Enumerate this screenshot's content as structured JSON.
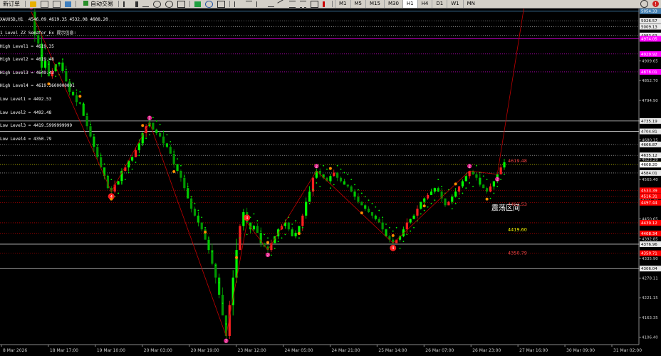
{
  "toolbar": {
    "new_order": "新订单",
    "auto_trade": "自动交易",
    "timeframes": [
      "M1",
      "M5",
      "M15",
      "M30",
      "H1",
      "H4",
      "D1",
      "W1",
      "MN"
    ],
    "active_timeframe": "H1"
  },
  "info": {
    "header": "XAUUSD,H1  4546.09 4619.35 4532.08 4608.20",
    "indicator": "1 Level ZZ Semafor_Ex 提示信息:",
    "lines": [
      "High Level1 = 4619.35",
      "High Level2 = 4619.48",
      "High Level3 = 4649.43",
      "High Level4 = 4619.3600000001",
      "Low Level1 = 4492.53",
      "Low Level2 = 4492.48",
      "Low Level3 = 4419.5999999999",
      "Low Level4 = 4350.79"
    ]
  },
  "annotation": "震荡区间",
  "chart_data": {
    "type": "candlestick",
    "symbol": "XAUUSD",
    "timeframe": "H1",
    "ohlc": {
      "open": 4546.09,
      "high": 4619.35,
      "low": 4532.08,
      "close": 4608.2
    },
    "ylim": [
      4085,
      5062
    ],
    "x_ticks": [
      "8 Mar 2026",
      "18 Mar 17:00",
      "19 Mar 10:00",
      "20 Mar 03:00",
      "20 Mar 19:00",
      "23 Mar 12:00",
      "24 Mar 05:00",
      "24 Mar 21:00",
      "25 Mar 14:00",
      "26 Mar 07:00",
      "26 Mar 23:00",
      "27 Mar 16:00",
      "30 Mar 09:00",
      "31 Mar 02:00"
    ],
    "y_ticks": [
      4909.65,
      4852.7,
      4794.9,
      4735.19,
      4680.15,
      4623.29,
      4565.4,
      4507.7,
      4450.65,
      4392.85,
      4335.9,
      4278.11,
      4221.15,
      4163.35,
      4106.4
    ],
    "path": [
      5052,
      4985,
      4960,
      4890,
      4910,
      4865,
      4880,
      4900,
      4905,
      4880,
      4850,
      4820,
      4810,
      4790,
      4785,
      4750,
      4720,
      4690,
      4660,
      4630,
      4600,
      4575,
      4540,
      4530,
      4550,
      4560,
      4590,
      4600,
      4620,
      4630,
      4650,
      4670,
      4700,
      4720,
      4730,
      4710,
      4700,
      4690,
      4670,
      4660,
      4640,
      4610,
      4590,
      4570,
      4540,
      4510,
      4480,
      4460,
      4440,
      4420,
      4390,
      4360,
      4320,
      4280,
      4230,
      4170,
      4110,
      4200,
      4280,
      4360,
      4430,
      4470,
      4440,
      4420,
      4430,
      4410,
      4380,
      4370,
      4360,
      4380,
      4400,
      4420,
      4430,
      4440,
      4420,
      4400,
      4410,
      4430,
      4460,
      4500,
      4530,
      4570,
      4590,
      4580,
      4570,
      4560,
      4575,
      4585,
      4570,
      4560,
      4550,
      4545,
      4530,
      4515,
      4500,
      4490,
      4480,
      4470,
      4460,
      4450,
      4440,
      4420,
      4400,
      4390,
      4380,
      4390,
      4400,
      4420,
      4440,
      4450,
      4460,
      4480,
      4500,
      4510,
      4520,
      4530,
      4540,
      4530,
      4510,
      4490,
      4500,
      4515,
      4530,
      4545,
      4560,
      4575,
      4590,
      4580,
      4570,
      4550,
      4540,
      4530,
      4545,
      4560,
      4580,
      4600,
      4615
    ],
    "series": [
      {
        "price": 5054.33,
        "label": "5054.33",
        "color": "#4682b4",
        "style": "solid"
      },
      {
        "price": 5026.57,
        "label": "5026.57",
        "color": "#cccccc",
        "style": "dotted"
      },
      {
        "price": 5009.13,
        "label": "5009.13",
        "color": "#cccccc",
        "style": "dotted"
      },
      {
        "price": 4983.63,
        "label": "4983.63",
        "color": "#cccccc",
        "style": "dotted"
      },
      {
        "price": 4974.05,
        "label": "4974.05",
        "color": "#ff00ff",
        "style": "solid"
      },
      {
        "price": 4929.92,
        "label": "4929.92",
        "color": "#ff00ff",
        "style": "dotted"
      },
      {
        "price": 4878.01,
        "label": "4878.01",
        "color": "#ff00ff",
        "style": "dotted"
      },
      {
        "price": 4735.19,
        "label": "4735.19",
        "color": "#cccccc",
        "style": "solid"
      },
      {
        "price": 4704.81,
        "label": "4704.81",
        "color": "#cccccc",
        "style": "solid"
      },
      {
        "price": 4666.87,
        "label": "4666.87",
        "color": "#cccccc",
        "style": "dotted"
      },
      {
        "price": 4635.12,
        "label": "4635.12",
        "color": "#cccccc",
        "style": "dotted"
      },
      {
        "price": 4608.59,
        "label": "4608.59",
        "color": "#ffff00",
        "style": "dotted"
      },
      {
        "price": 4584.01,
        "label": "4584.01",
        "color": "#cccccc",
        "style": "dotted"
      },
      {
        "price": 4533.39,
        "label": "4533.39",
        "color": "#ff0000",
        "style": "dotted"
      },
      {
        "price": 4516.31,
        "label": "4516.31",
        "color": "#ff0000",
        "style": "dotted"
      },
      {
        "price": 4497.44,
        "label": "4497.44",
        "color": "#ff0000",
        "style": "dotted"
      },
      {
        "price": 4439.12,
        "label": "4439.12",
        "color": "#ff0000",
        "style": "dotted"
      },
      {
        "price": 4408.34,
        "label": "4408.34",
        "color": "#ff0000",
        "style": "dotted"
      },
      {
        "price": 4376.96,
        "label": "4376.96",
        "color": "#cccccc",
        "style": "solid"
      },
      {
        "price": 4350.71,
        "label": "4350.71",
        "color": "#ff0000",
        "style": "dotted"
      },
      {
        "price": 4306.04,
        "label": "4306.04",
        "color": "#cccccc",
        "style": "solid"
      }
    ],
    "level_labels": [
      {
        "price": 4619.48,
        "label": "4619.48",
        "color": "#ff4444"
      },
      {
        "price": 4492.53,
        "label": "4492.53",
        "color": "#ff4444"
      },
      {
        "price": 4419.6,
        "label": "4419.60",
        "color": "#ffff00"
      },
      {
        "price": 4350.79,
        "label": "4350.79",
        "color": "#ff4444"
      }
    ],
    "bid": {
      "price": 4608.2,
      "label": "4608.20"
    },
    "pivots": [
      {
        "i": 0,
        "kind": "high"
      },
      {
        "i": 23,
        "kind": "low"
      },
      {
        "i": 34,
        "kind": "high"
      },
      {
        "i": 56,
        "kind": "low"
      },
      {
        "i": 62,
        "kind": "high"
      },
      {
        "i": 68,
        "kind": "low"
      },
      {
        "i": 82,
        "kind": "high"
      },
      {
        "i": 104,
        "kind": "low"
      },
      {
        "i": 126,
        "kind": "high"
      },
      {
        "i": 134,
        "kind": "low"
      },
      {
        "i": 142,
        "kind": "high"
      }
    ]
  }
}
